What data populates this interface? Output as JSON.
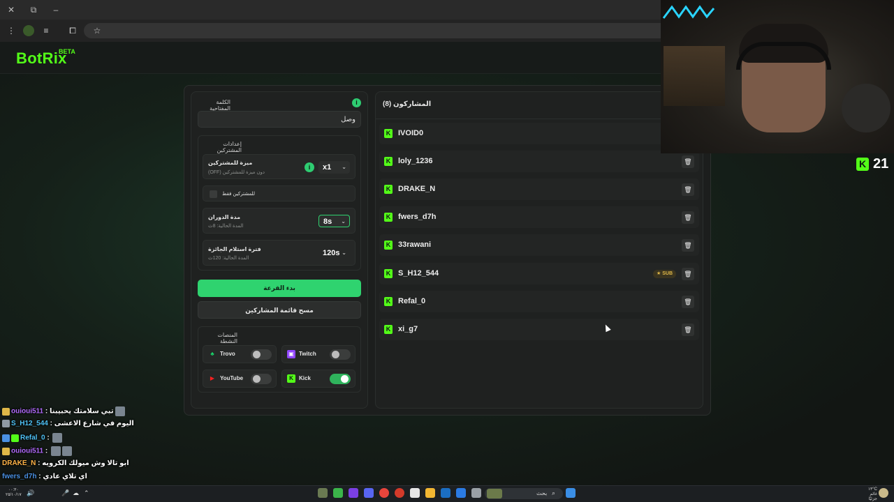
{
  "site": {
    "logo": "BotRix",
    "beta": "BETA"
  },
  "keyword": {
    "label": "الكلمة المفتاحية",
    "value": "وصل"
  },
  "settings": {
    "title": "إعدادات المشتركين",
    "advantage": {
      "title": "ميزة للمشتركين",
      "sub": "(OFF) دون ميزة للمشتركين",
      "value": "x1"
    },
    "subs_only": {
      "label": "للمشتركين فقط"
    },
    "spin": {
      "title": "مدة الدوران",
      "sub": "المدة الحالية: 8ث",
      "value": "8s"
    },
    "claim": {
      "title": "فترة استلام الجائزة",
      "sub": "المدة الحالية: 120ث",
      "value": "120s"
    }
  },
  "buttons": {
    "start": "بدء القرعة",
    "clear": "مسح قائمة المشاركين"
  },
  "platforms": {
    "title": "المنصات النشطة",
    "items": [
      {
        "name": "Trovo",
        "on": false,
        "color": "#19d66b"
      },
      {
        "name": "Twitch",
        "on": false,
        "color": "#9146ff"
      },
      {
        "name": "YouTube",
        "on": false,
        "color": "#ff0000"
      },
      {
        "name": "Kick",
        "on": true,
        "color": "#53fc18"
      }
    ]
  },
  "participants": {
    "title": "المشاركون (8)",
    "list": [
      {
        "name": "IVOID0",
        "sub": false
      },
      {
        "name": "loly_1236",
        "sub": false
      },
      {
        "name": "DRAKE_N",
        "sub": false
      },
      {
        "name": "fwers_d7h",
        "sub": false
      },
      {
        "name": "33rawani",
        "sub": false
      },
      {
        "name": "S_H12_544",
        "sub": true,
        "badge": "SUB"
      },
      {
        "name": "Refal_0",
        "sub": false
      },
      {
        "name": "xi_g7",
        "sub": false
      }
    ]
  },
  "stream": {
    "kick_count": "21"
  },
  "chat": [
    {
      "user": "ouioui511",
      "color": "#b26bff",
      "text": " : تبي سلامتك يحبيبنا"
    },
    {
      "user": "S_H12_544",
      "color": "#4fc3f7",
      "text": " : اليوم في شارع الاعشى"
    },
    {
      "user": "Refal_0",
      "color": "#4fc3f7",
      "text": " : "
    },
    {
      "user": "ouioui511",
      "color": "#b26bff",
      "text": " : "
    },
    {
      "user": "DRAKE_N",
      "color": "#ffb347",
      "text": " : ابو تالا وش ميولك الكرويه"
    },
    {
      "user": "fwers_d7h",
      "color": "#4a90e2",
      "text": " : اي تلاي عادي"
    }
  ],
  "taskbar": {
    "search": "بحث",
    "weather": "١٣°C",
    "weather_sub": "غائم جزئيًا",
    "time": "٠٠:٣٠",
    "date": "٢٥/١٠/١٧"
  },
  "colors": {
    "accent": "#2fd36f",
    "kick": "#53fc18",
    "bg": "#131916"
  }
}
